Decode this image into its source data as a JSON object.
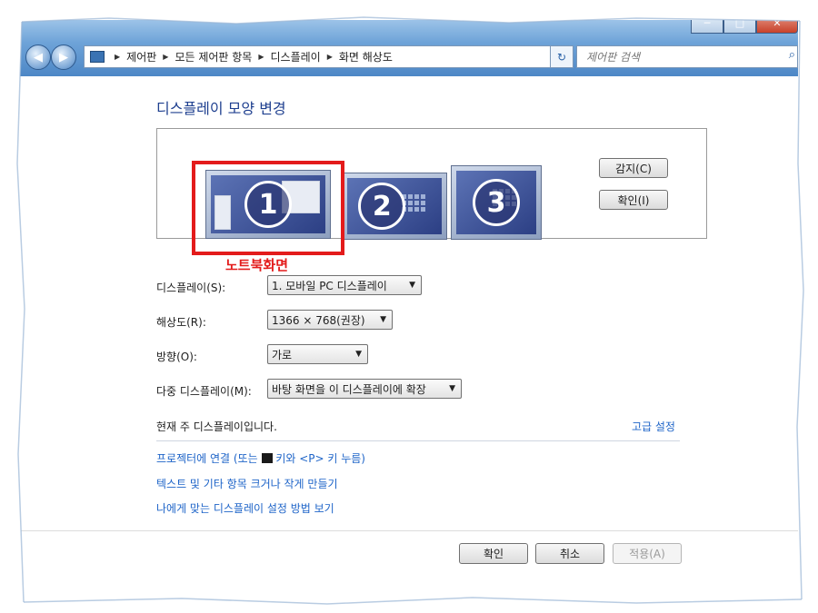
{
  "address_bar": {
    "breadcrumbs": [
      "제어판",
      "모든 제어판 항목",
      "디스플레이",
      "화면 해상도"
    ]
  },
  "search": {
    "placeholder": "제어판 검색"
  },
  "window_buttons": {
    "minimize": "─",
    "maximize": "□",
    "close": "✕"
  },
  "heading": "디스플레이 모양 변경",
  "monitors": [
    {
      "number": "1"
    },
    {
      "number": "2"
    },
    {
      "number": "3"
    }
  ],
  "annotation_label": "노트북화면",
  "side_buttons": {
    "detect": "감지(C)",
    "identify": "확인(I)"
  },
  "settings": {
    "display": {
      "label": "디스플레이(S):",
      "value": "1. 모바일 PC 디스플레이"
    },
    "resolution": {
      "label": "해상도(R):",
      "value": "1366 × 768(권장)"
    },
    "orientation": {
      "label": "방향(O):",
      "value": "가로"
    },
    "multiple": {
      "label": "다중 디스플레이(M):",
      "value": "바탕 화면을 이 디스플레이에 확장"
    }
  },
  "status_text": "현재 주 디스플레이입니다.",
  "advanced_link": "고급 설정",
  "links": {
    "projector_prefix": "프로젝터에 연결 (또는 ",
    "projector_suffix": " 키와 <P> 키 누름)",
    "text_size": "텍스트 및 기타 항목 크거나 작게 만들기",
    "help": "나에게 맞는 디스플레이 설정 방법 보기"
  },
  "dialog_buttons": {
    "ok": "확인",
    "cancel": "취소",
    "apply": "적용(A)"
  },
  "colors": {
    "accent_red": "#e31b1b",
    "link_blue": "#1e64c8",
    "heading_blue": "#1e3f8f"
  }
}
